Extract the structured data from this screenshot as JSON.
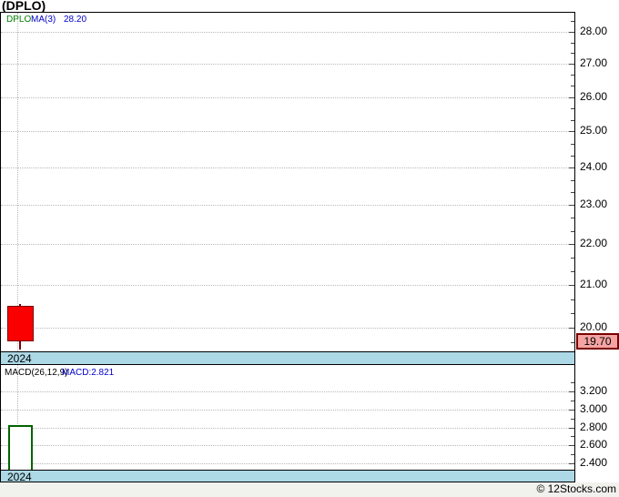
{
  "title": "(DPLO)",
  "footer": "© 12Stocks.com",
  "main_chart": {
    "legend": {
      "symbol": "DPLO",
      "ma": "MA(3)",
      "ma_value": "28.20"
    },
    "y_tick_labels": [
      "28.00",
      "27.00",
      "26.00",
      "25.00",
      "24.00",
      "23.00",
      "22.00",
      "21.00",
      "20.00"
    ],
    "last_price": "19.70",
    "x_label": "2024"
  },
  "macd": {
    "legend": "MACD(26,12,9)",
    "legend_value": "MACD:2.821",
    "y_tick_labels": [
      "3.200",
      "3.000",
      "2.800",
      "2.600",
      "2.400"
    ],
    "x_label": "2024"
  },
  "colors": {
    "candle_down_fill": "#fb0000",
    "candle_down_border": "#7a0000",
    "macd_bar_border": "#006400",
    "band_blue": "#add8e6",
    "price_tag_bg": "#f5a3a3",
    "price_tag_border": "#7a0000",
    "legend_green": "#008000",
    "legend_blue": "#0000cd"
  },
  "chart_data": [
    {
      "type": "candlestick",
      "title": "(DPLO)",
      "x": [
        "2024"
      ],
      "series": [
        {
          "name": "DPLO",
          "ohlc": [
            {
              "open": 20.5,
              "high": 20.55,
              "low": 19.5,
              "close": 19.7
            }
          ]
        }
      ],
      "overlays": [
        {
          "name": "MA(3)",
          "last_value": 28.2
        }
      ],
      "y_axis": {
        "scale": "log",
        "ticks": [
          28,
          27,
          26,
          25,
          24,
          23,
          22,
          21,
          20
        ],
        "last_price_marker": 19.7,
        "side": "right"
      },
      "grid": "dotted",
      "legend_position": "top-left"
    },
    {
      "type": "bar",
      "title": "MACD(26,12,9)",
      "x": [
        "2024"
      ],
      "values": [
        2.821
      ],
      "bar_style": "hollow-green",
      "y_axis": {
        "scale": "linear",
        "ticks": [
          3.2,
          3.0,
          2.8,
          2.6,
          2.4
        ],
        "side": "right"
      },
      "grid": "dotted",
      "legend_position": "top-left"
    }
  ]
}
